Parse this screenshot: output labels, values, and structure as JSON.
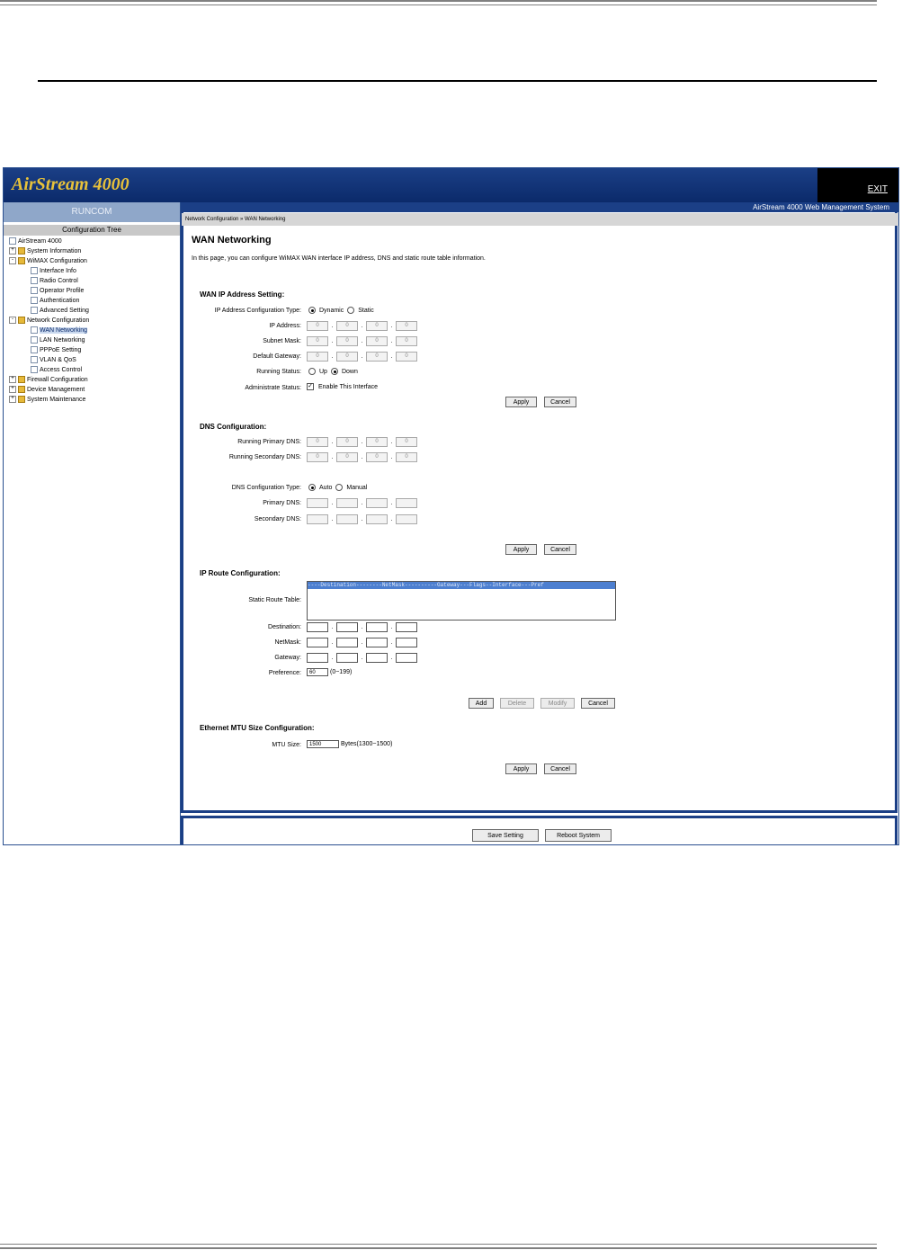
{
  "app": {
    "brand": "AirStream 4000",
    "exit_label": "EXIT",
    "side_brand": "RUNCOM",
    "tree_header": "Configuration Tree",
    "system_title": "AirStream 4000 Web Management System",
    "breadcrumb": "Network Configuration » WAN Networking"
  },
  "tree": {
    "items": [
      {
        "label": "AirStream 4000"
      },
      {
        "label": "System Information"
      },
      {
        "label": "WiMAX Configuration"
      },
      {
        "label": "Interface Info"
      },
      {
        "label": "Radio Control"
      },
      {
        "label": "Operator Profile"
      },
      {
        "label": "Authentication"
      },
      {
        "label": "Advanced Setting"
      },
      {
        "label": "Network Configuration"
      },
      {
        "label": "WAN Networking"
      },
      {
        "label": "LAN Networking"
      },
      {
        "label": "PPPoE Setting"
      },
      {
        "label": "VLAN & QoS"
      },
      {
        "label": "Access Control"
      },
      {
        "label": "Firewall Configuration"
      },
      {
        "label": "Device Management"
      },
      {
        "label": "System Maintenance"
      }
    ]
  },
  "page": {
    "title": "WAN Networking",
    "description": "In this page, you can configure WiMAX WAN interface IP address, DNS and static route table information."
  },
  "wan": {
    "heading": "WAN IP Address Setting:",
    "cfg_type_label": "IP Address Configuration Type:",
    "opt_dynamic": "Dynamic",
    "opt_static": "Static",
    "ip_label": "IP Address:",
    "mask_label": "Subnet Mask:",
    "gw_label": "Default Gateway:",
    "ip": [
      "0",
      "0",
      "0",
      "0"
    ],
    "mask": [
      "0",
      "0",
      "0",
      "0"
    ],
    "gw": [
      "0",
      "0",
      "0",
      "0"
    ],
    "running_label": "Running Status:",
    "opt_up": "Up",
    "opt_down": "Down",
    "admin_label": "Administrate Status:",
    "admin_check": "Enable This Interface",
    "apply": "Apply",
    "cancel": "Cancel"
  },
  "dns": {
    "heading": "DNS Configuration:",
    "run_primary_label": "Running Primary DNS:",
    "run_secondary_label": "Running Secondary DNS:",
    "run_primary": [
      "0",
      "0",
      "0",
      "0"
    ],
    "run_secondary": [
      "0",
      "0",
      "0",
      "0"
    ],
    "type_label": "DNS Configuration Type:",
    "opt_auto": "Auto",
    "opt_manual": "Manual",
    "primary_label": "Primary DNS:",
    "secondary_label": "Secondary DNS:",
    "apply": "Apply",
    "cancel": "Cancel"
  },
  "route": {
    "heading": "IP Route Configuration:",
    "table_label": "Static Route Table:",
    "table_header": "----Destination--------NetMask----------Gateway---Flags--Interface---Pref",
    "dest_label": "Destination:",
    "mask_label": "NetMask:",
    "gw_label": "Gateway:",
    "pref_label": "Preference:",
    "pref_value": "60",
    "pref_range": "(0~199)",
    "add": "Add",
    "delete": "Delete",
    "modify": "Modify",
    "cancel": "Cancel"
  },
  "mtu": {
    "heading": "Ethernet MTU Size Configuration:",
    "label": "MTU Size:",
    "value": "1500",
    "unit": "Bytes(1300~1500)",
    "apply": "Apply",
    "cancel": "Cancel"
  },
  "footer": {
    "save": "Save Setting",
    "reboot": "Reboot System"
  }
}
